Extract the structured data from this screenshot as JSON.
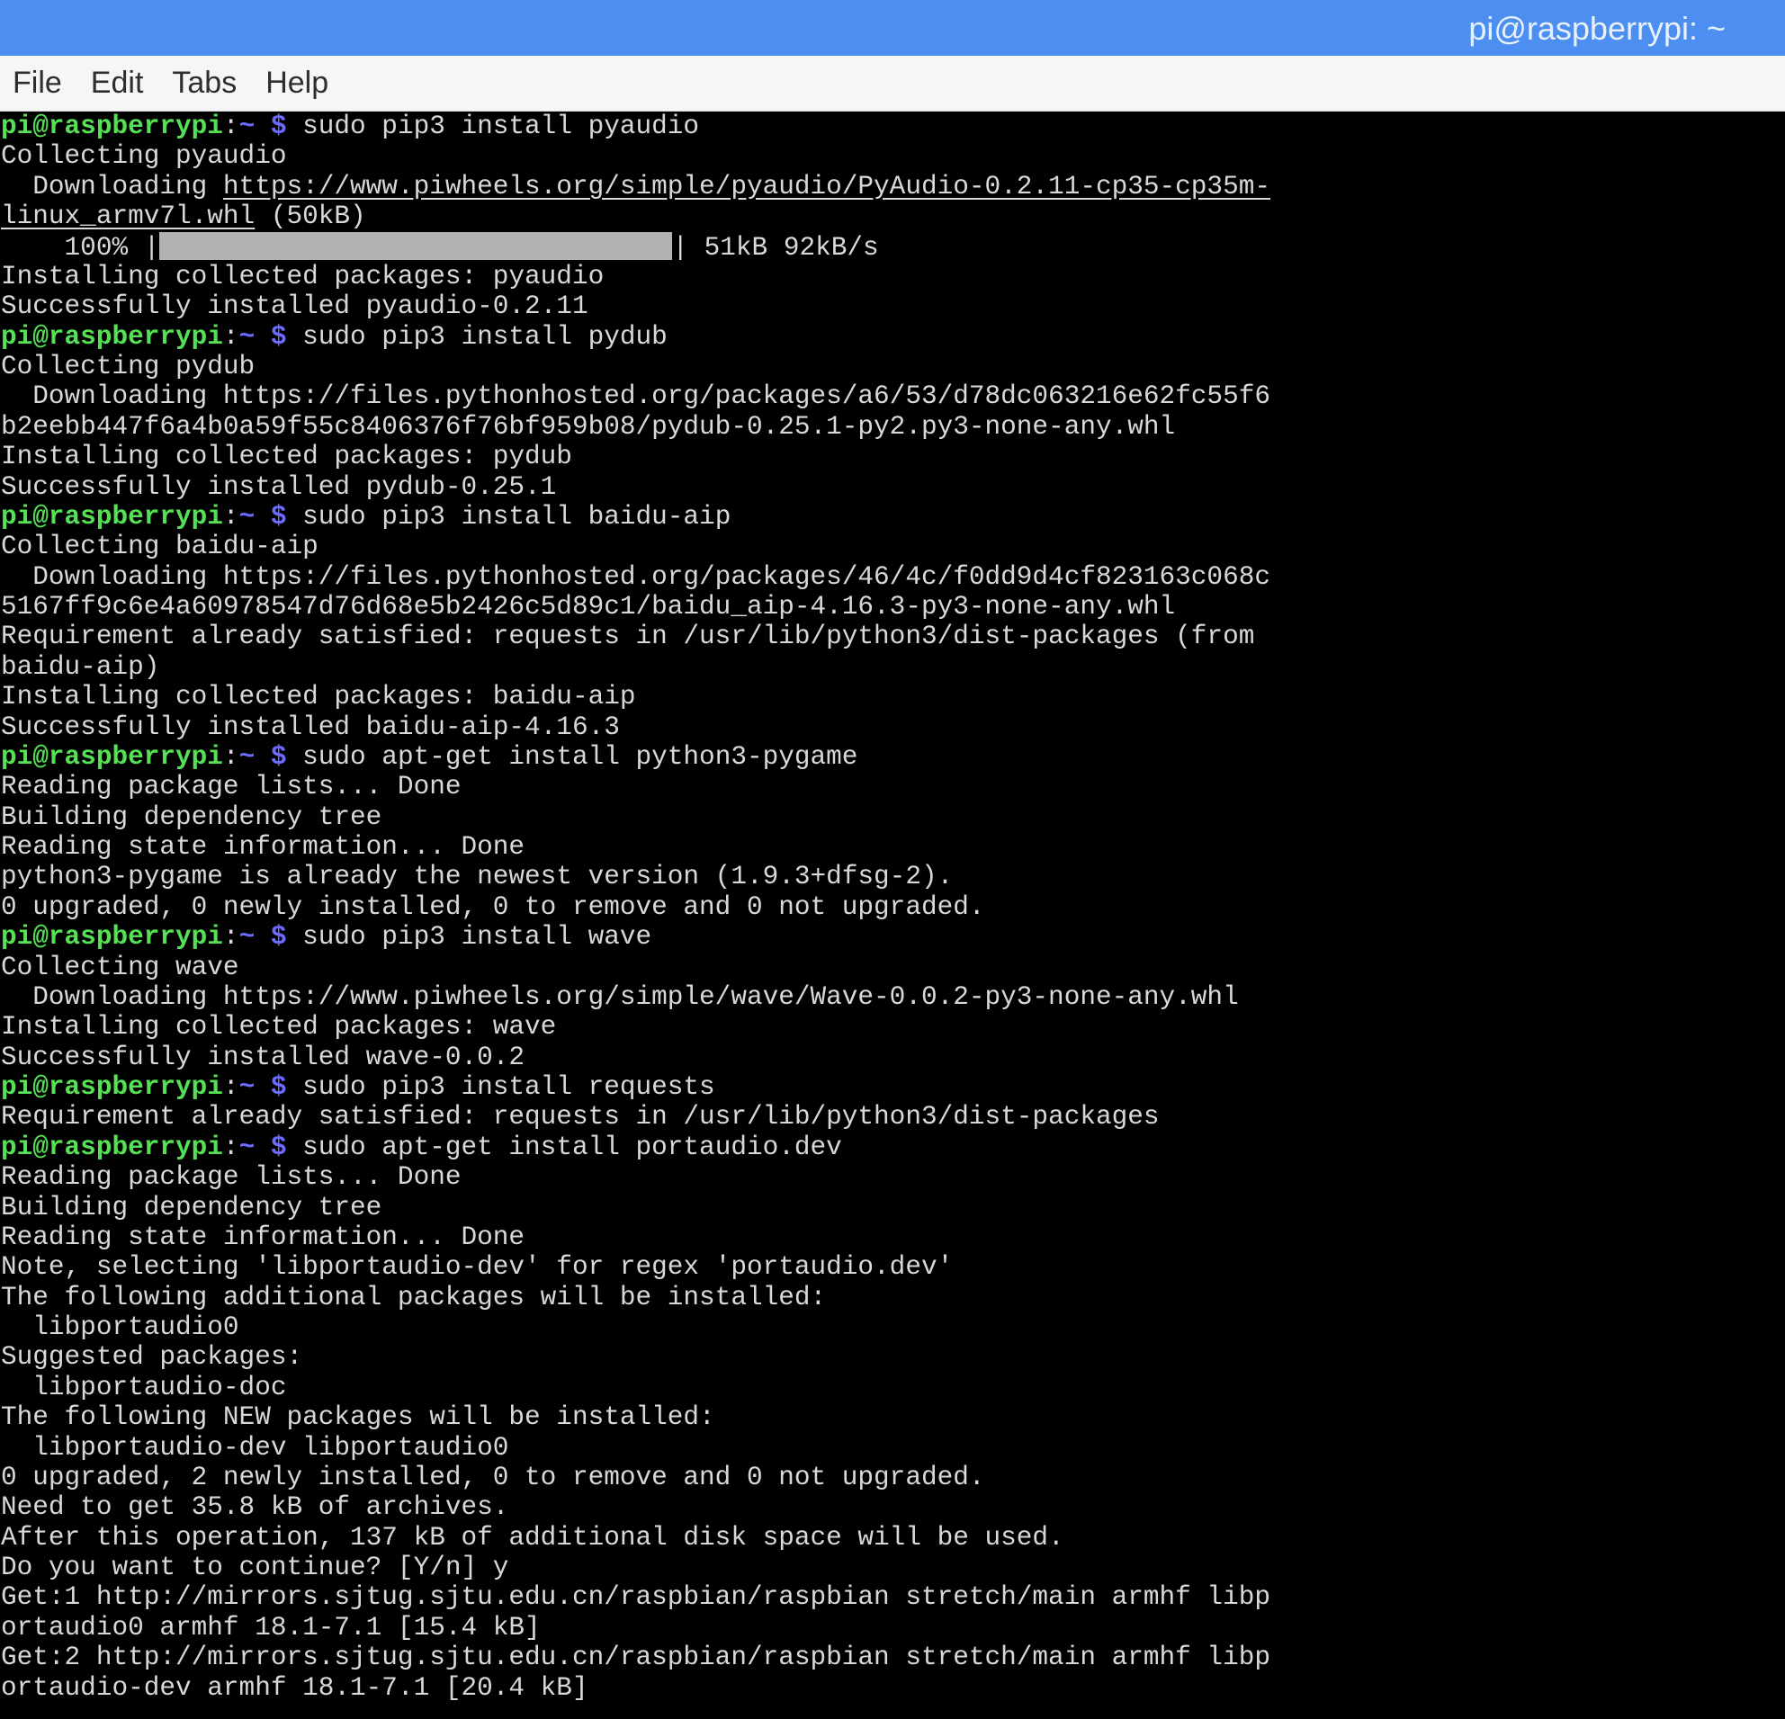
{
  "window": {
    "title": "pi@raspberrypi: ~"
  },
  "menu": [
    "File",
    "Edit",
    "Tabs",
    "Help"
  ],
  "prompt": {
    "user": "pi@raspberrypi",
    "sep": ":",
    "dir": "~ $"
  },
  "lines": [
    {
      "type": "prompt",
      "cmd": " sudo pip3 install pyaudio"
    },
    {
      "type": "text",
      "text": "Collecting pyaudio"
    },
    {
      "type": "text",
      "text": "  Downloading ",
      "link": "https://www.piwheels.org/simple/pyaudio/PyAudio-0.2.11-cp35-cp35m-"
    },
    {
      "type": "text",
      "text": "",
      "link": "linux_armv7l.whl",
      "after": " (50kB)"
    },
    {
      "type": "progress",
      "before": "    100% |",
      "after": "| 51kB 92kB/s",
      "fraction": 1.0
    },
    {
      "type": "text",
      "text": "Installing collected packages: pyaudio"
    },
    {
      "type": "text",
      "text": "Successfully installed pyaudio-0.2.11"
    },
    {
      "type": "prompt",
      "cmd": " sudo pip3 install pydub"
    },
    {
      "type": "text",
      "text": "Collecting pydub"
    },
    {
      "type": "text",
      "text": "  Downloading https://files.pythonhosted.org/packages/a6/53/d78dc063216e62fc55f6"
    },
    {
      "type": "text",
      "text": "b2eebb447f6a4b0a59f55c8406376f76bf959b08/pydub-0.25.1-py2.py3-none-any.whl"
    },
    {
      "type": "text",
      "text": "Installing collected packages: pydub"
    },
    {
      "type": "text",
      "text": "Successfully installed pydub-0.25.1"
    },
    {
      "type": "prompt",
      "cmd": " sudo pip3 install baidu-aip"
    },
    {
      "type": "text",
      "text": "Collecting baidu-aip"
    },
    {
      "type": "text",
      "text": "  Downloading https://files.pythonhosted.org/packages/46/4c/f0dd9d4cf823163c068c"
    },
    {
      "type": "text",
      "text": "5167ff9c6e4a60978547d76d68e5b2426c5d89c1/baidu_aip-4.16.3-py3-none-any.whl"
    },
    {
      "type": "text",
      "text": "Requirement already satisfied: requests in /usr/lib/python3/dist-packages (from"
    },
    {
      "type": "text",
      "text": "baidu-aip)"
    },
    {
      "type": "text",
      "text": "Installing collected packages: baidu-aip"
    },
    {
      "type": "text",
      "text": "Successfully installed baidu-aip-4.16.3"
    },
    {
      "type": "prompt",
      "cmd": " sudo apt-get install python3-pygame"
    },
    {
      "type": "text",
      "text": "Reading package lists... Done"
    },
    {
      "type": "text",
      "text": "Building dependency tree"
    },
    {
      "type": "text",
      "text": "Reading state information... Done"
    },
    {
      "type": "text",
      "text": "python3-pygame is already the newest version (1.9.3+dfsg-2)."
    },
    {
      "type": "text",
      "text": "0 upgraded, 0 newly installed, 0 to remove and 0 not upgraded."
    },
    {
      "type": "prompt",
      "cmd": " sudo pip3 install wave"
    },
    {
      "type": "text",
      "text": "Collecting wave"
    },
    {
      "type": "text",
      "text": "  Downloading https://www.piwheels.org/simple/wave/Wave-0.0.2-py3-none-any.whl"
    },
    {
      "type": "text",
      "text": "Installing collected packages: wave"
    },
    {
      "type": "text",
      "text": "Successfully installed wave-0.0.2"
    },
    {
      "type": "prompt",
      "cmd": " sudo pip3 install requests"
    },
    {
      "type": "text",
      "text": "Requirement already satisfied: requests in /usr/lib/python3/dist-packages"
    },
    {
      "type": "prompt",
      "cmd": " sudo apt-get install portaudio.dev"
    },
    {
      "type": "text",
      "text": "Reading package lists... Done"
    },
    {
      "type": "text",
      "text": "Building dependency tree"
    },
    {
      "type": "text",
      "text": "Reading state information... Done"
    },
    {
      "type": "text",
      "text": "Note, selecting 'libportaudio-dev' for regex 'portaudio.dev'"
    },
    {
      "type": "text",
      "text": "The following additional packages will be installed:"
    },
    {
      "type": "text",
      "text": "  libportaudio0"
    },
    {
      "type": "text",
      "text": "Suggested packages:"
    },
    {
      "type": "text",
      "text": "  libportaudio-doc"
    },
    {
      "type": "text",
      "text": "The following NEW packages will be installed:"
    },
    {
      "type": "text",
      "text": "  libportaudio-dev libportaudio0"
    },
    {
      "type": "text",
      "text": "0 upgraded, 2 newly installed, 0 to remove and 0 not upgraded."
    },
    {
      "type": "text",
      "text": "Need to get 35.8 kB of archives."
    },
    {
      "type": "text",
      "text": "After this operation, 137 kB of additional disk space will be used."
    },
    {
      "type": "text",
      "text": "Do you want to continue? [Y/n] y"
    },
    {
      "type": "text",
      "text": "Get:1 http://mirrors.sjtug.sjtu.edu.cn/raspbian/raspbian stretch/main armhf libp"
    },
    {
      "type": "text",
      "text": "ortaudio0 armhf 18.1-7.1 [15.4 kB]"
    },
    {
      "type": "text",
      "text": "Get:2 http://mirrors.sjtug.sjtu.edu.cn/raspbian/raspbian stretch/main armhf libp"
    },
    {
      "type": "text",
      "text": "ortaudio-dev armhf 18.1-7.1 [20.4 kB]"
    }
  ]
}
